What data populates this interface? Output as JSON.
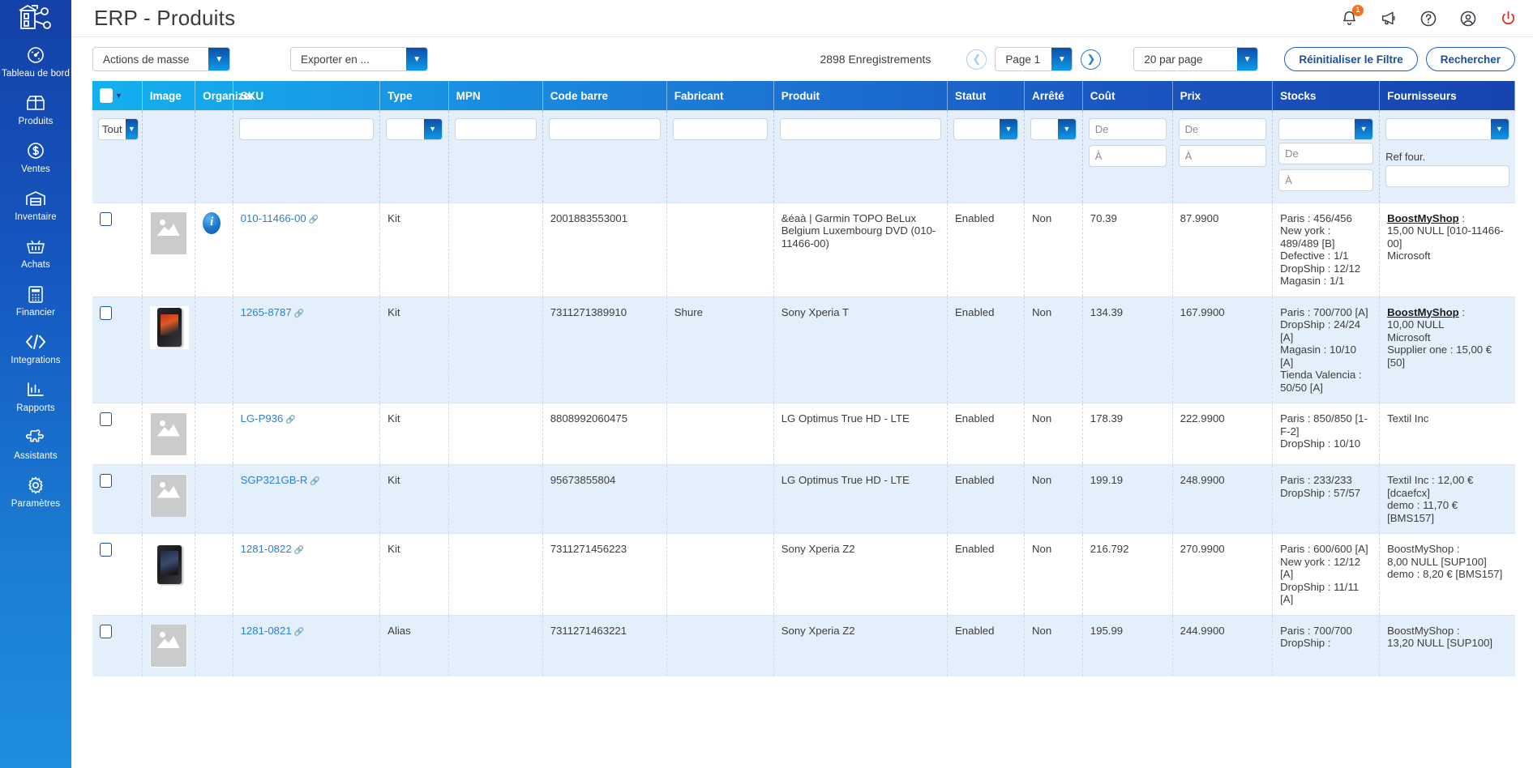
{
  "app": {
    "title": "ERP - Produits",
    "logo_icon": "boostmyshop-logo-icon"
  },
  "header": {
    "icons": [
      {
        "name": "bell-icon",
        "badge": "1"
      },
      {
        "name": "megaphone-icon",
        "badge": ""
      },
      {
        "name": "help-icon",
        "badge": ""
      },
      {
        "name": "user-account-icon",
        "badge": ""
      },
      {
        "name": "power-icon",
        "badge": ""
      }
    ]
  },
  "sidebar": {
    "items": [
      {
        "label": "Tableau de bord",
        "icon": "dashboard-gauge-icon"
      },
      {
        "label": "Produits",
        "icon": "box-open-icon"
      },
      {
        "label": "Ventes",
        "icon": "dollar-circle-icon"
      },
      {
        "label": "Inventaire",
        "icon": "warehouse-icon"
      },
      {
        "label": "Achats",
        "icon": "basket-icon"
      },
      {
        "label": "Financier",
        "icon": "calculator-icon"
      },
      {
        "label": "Integrations",
        "icon": "code-brackets-icon"
      },
      {
        "label": "Rapports",
        "icon": "bar-chart-icon"
      },
      {
        "label": "Assistants",
        "icon": "puzzle-piece-icon"
      },
      {
        "label": "Paramètres",
        "icon": "gear-icon"
      }
    ]
  },
  "toolbar": {
    "bulk_actions_label": "Actions de masse",
    "export_label": "Exporter en ...",
    "records_count": "2898 Enregistrements",
    "prev_page_icon": "chevron-left-circle-icon",
    "next_page_icon": "chevron-right-circle-icon",
    "page_label": "Page 1",
    "per_page_label": "20 par page",
    "reset_filter_label": "Réinitialiser le Filtre",
    "search_label": "Rechercher"
  },
  "table": {
    "columns": [
      "",
      "Image",
      "Organizer",
      "SKU",
      "Type",
      "MPN",
      "Code barre",
      "Fabricant",
      "Produit",
      "Statut",
      "Arrêté",
      "Coût",
      "Prix",
      "Stocks",
      "Fournisseurs"
    ],
    "filters": {
      "select_all_label": "Tout",
      "sku_value": "",
      "type_value": "",
      "mpn_value": "",
      "barcode_value": "",
      "manufacturer_value": "",
      "product_value": "",
      "status_value": "",
      "discontinued_value": "",
      "cost_from_placeholder": "De",
      "cost_to_placeholder": "À",
      "price_from_placeholder": "De",
      "price_to_placeholder": "À",
      "stock_select_value": "",
      "stock_from_placeholder": "De",
      "stock_to_placeholder": "À",
      "supplier_select_value": "",
      "supplier_ref_label": "Ref four.",
      "supplier_ref_value": ""
    },
    "rows": [
      {
        "image": "placeholder",
        "organizer": "info-icon",
        "sku": "010-11466-00",
        "type": "Kit",
        "mpn": "",
        "barcode": "2001883553001",
        "manufacturer": "",
        "product": "&éaà | Garmin TOPO BeLux Belgium Luxembourg DVD (010-11466-00)",
        "status": "Enabled",
        "discontinued": "Non",
        "cost": "70.39",
        "price": "87.9900",
        "stocks": "Paris : 456/456\nNew york : 489/489 [B]\nDefective : 1/1\nDropShip : 12/12\nMagasin : 1/1",
        "supplier_name": "BoostMyShop",
        "supplier_rest": " :\n15,00 NULL [010-11466-00]\nMicrosoft"
      },
      {
        "image": "phone-red",
        "organizer": "",
        "sku": "1265-8787",
        "type": "Kit",
        "mpn": "",
        "barcode": "7311271389910",
        "manufacturer": "Shure",
        "product": "Sony Xperia T",
        "status": "Enabled",
        "discontinued": "Non",
        "cost": "134.39",
        "price": "167.9900",
        "stocks": "Paris : 700/700 [A]\nDropShip : 24/24 [A]\nMagasin : 10/10 [A]\nTienda Valencia : 50/50 [A]",
        "supplier_name": "BoostMyShop",
        "supplier_rest": " :\n10,00 NULL\nMicrosoft\nSupplier one : 15,00 € [50]"
      },
      {
        "image": "placeholder",
        "organizer": "",
        "sku": "LG-P936",
        "type": "Kit",
        "mpn": "",
        "barcode": "8808992060475",
        "manufacturer": "",
        "product": "LG Optimus True HD - LTE",
        "status": "Enabled",
        "discontinued": "Non",
        "cost": "178.39",
        "price": "222.9900",
        "stocks": "Paris : 850/850 [1-F-2]\nDropShip : 10/10",
        "supplier_name": "",
        "supplier_rest": "Textil Inc"
      },
      {
        "image": "placeholder",
        "organizer": "",
        "sku": "SGP321GB-R",
        "type": "Kit",
        "mpn": "",
        "barcode": "95673855804",
        "manufacturer": "",
        "product": "LG Optimus True HD - LTE",
        "status": "Enabled",
        "discontinued": "Non",
        "cost": "199.19",
        "price": "248.9900",
        "stocks": "Paris : 233/233\nDropShip : 57/57",
        "supplier_name": "",
        "supplier_rest": "Textil Inc : 12,00 € [dcaefcx]\ndemo : 11,70 € [BMS157]"
      },
      {
        "image": "phone-blue",
        "organizer": "",
        "sku": "1281-0822",
        "type": "Kit",
        "mpn": "",
        "barcode": "7311271456223",
        "manufacturer": "",
        "product": "Sony Xperia Z2",
        "status": "Enabled",
        "discontinued": "Non",
        "cost": "216.792",
        "price": "270.9900",
        "stocks": "Paris : 600/600 [A]\nNew york : 12/12 [A]\nDropShip : 11/11 [A]",
        "supplier_name": "",
        "supplier_rest": "BoostMyShop :\n8,00 NULL [SUP100]\ndemo : 8,20 € [BMS157]"
      },
      {
        "image": "placeholder",
        "organizer": "",
        "sku": "1281-0821",
        "type": "Alias",
        "mpn": "",
        "barcode": "7311271463221",
        "manufacturer": "",
        "product": "Sony Xperia Z2",
        "status": "Enabled",
        "discontinued": "Non",
        "cost": "195.99",
        "price": "244.9900",
        "stocks": "Paris : 700/700\nDropShip :",
        "supplier_name": "",
        "supplier_rest": "BoostMyShop :\n13,20 NULL [SUP100]"
      }
    ]
  },
  "colors": {
    "sidebar_top": "#1442a8",
    "sidebar_bottom": "#1f8ede",
    "header_grad_left": "#12b0ef",
    "header_grad_right": "#1744ae",
    "accent": "#1a4fa0",
    "link": "#2f7fd0",
    "row_even": "#e4effc",
    "badge": "#f4701b",
    "power_red": "#e02b20"
  }
}
